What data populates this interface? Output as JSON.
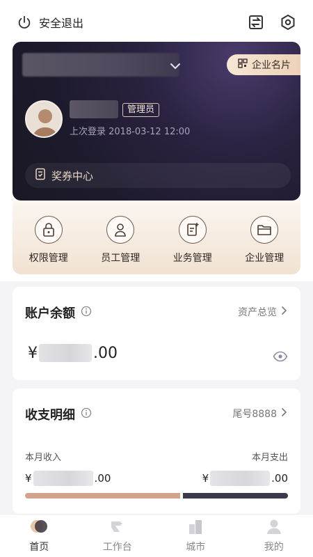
{
  "header": {
    "logout_label": "安全退出",
    "icons": [
      "power-icon",
      "switch-icon",
      "settings-icon"
    ]
  },
  "card": {
    "company_name": "",
    "business_card_label": "企业名片",
    "user_name": "",
    "role": "管理员",
    "last_login": "上次登录 2018-03-12 12:00",
    "voucher_label": "奖券中心"
  },
  "actions": [
    {
      "label": "权限管理",
      "icon": "lock-icon"
    },
    {
      "label": "员工管理",
      "icon": "person-icon"
    },
    {
      "label": "业务管理",
      "icon": "doc-add-icon"
    },
    {
      "label": "企业管理",
      "icon": "folder-icon"
    }
  ],
  "balance": {
    "title": "账户余额",
    "link": "资产总览",
    "currency": "¥",
    "suffix": ".00"
  },
  "details": {
    "title": "收支明细",
    "link": "尾号8888",
    "income_label": "本月收入",
    "expense_label": "本月支出",
    "currency": "¥",
    "suffix": ".00",
    "income_ratio": 0.59
  },
  "tabs": [
    {
      "label": "首页",
      "active": true
    },
    {
      "label": "工作台",
      "active": false
    },
    {
      "label": "城市",
      "active": false
    },
    {
      "label": "我的",
      "active": false
    }
  ],
  "colors": {
    "income_bar": "#d4a38d",
    "expense_bar": "#3b3a4a",
    "card_dark": "#1d1a2c",
    "gold": "#ecd2b7"
  }
}
